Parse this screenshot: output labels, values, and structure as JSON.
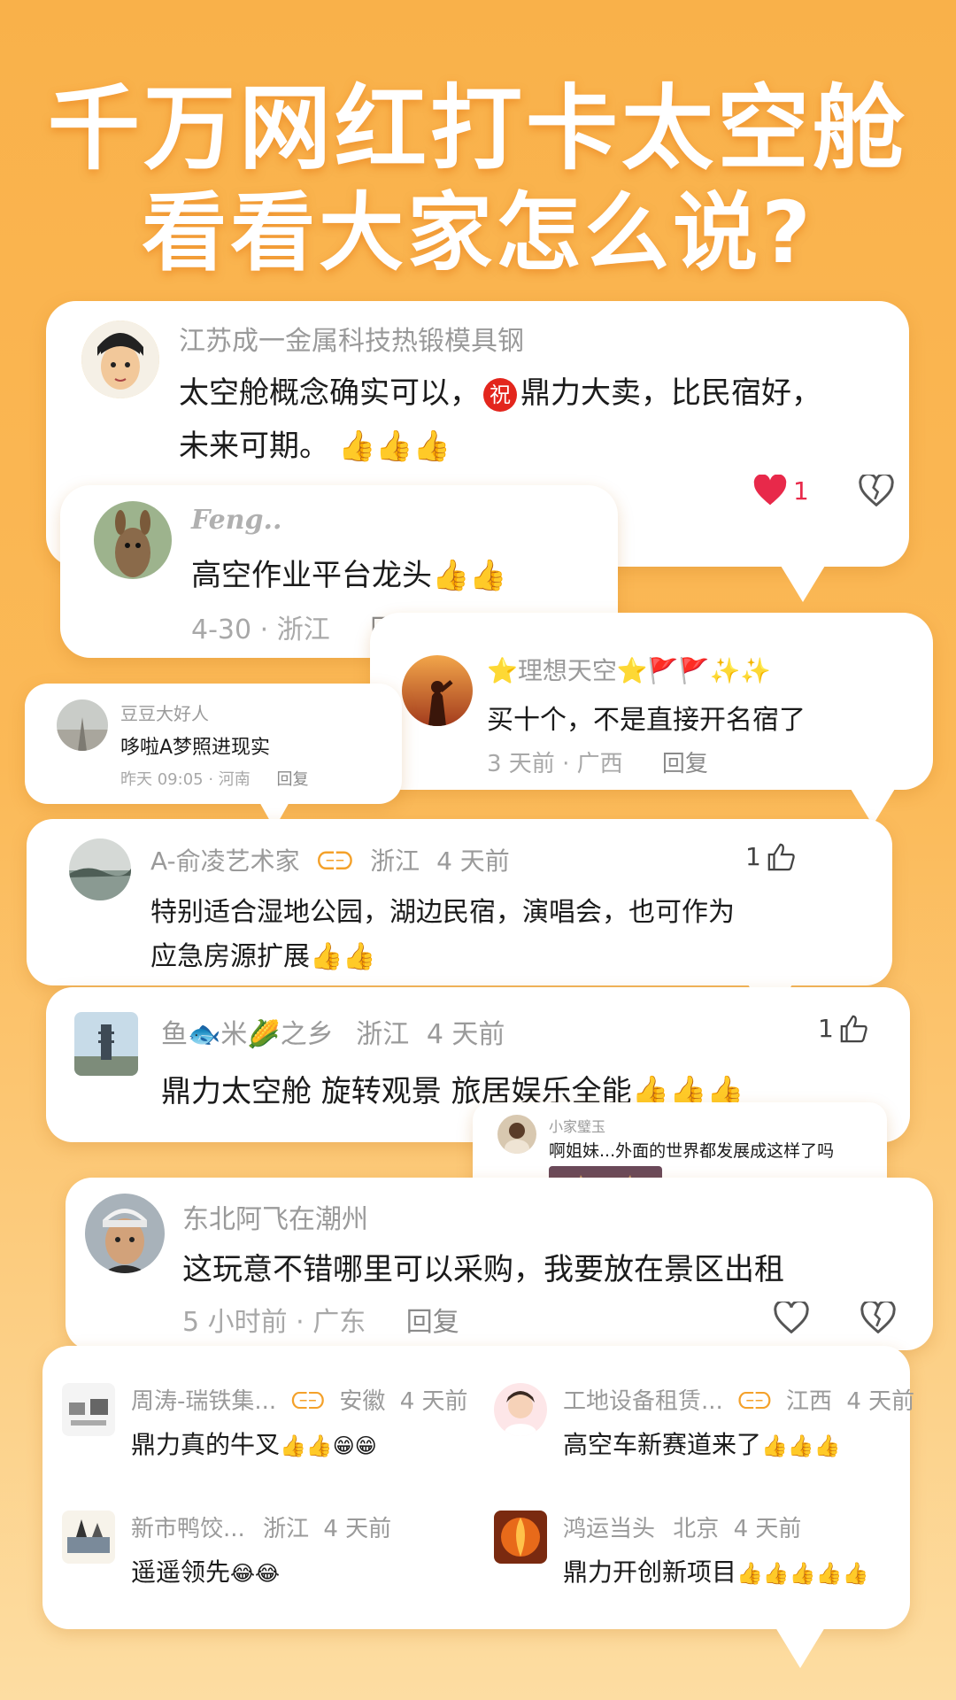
{
  "header": {
    "title_line1": "千万网红打卡太空舱",
    "title_line2": "看看大家怎么说?"
  },
  "comments": {
    "c1": {
      "user": "江苏成一金属科技热锻模具钢",
      "text_a": "太空舱概念确实可以，",
      "badge": "祝",
      "text_b": "鼎力大卖，比民宿好，",
      "text_c": "未来可期。",
      "thumbs": "👍👍👍",
      "likes": "1"
    },
    "c2": {
      "user": "Feng..",
      "text": "高空作业平台龙头",
      "thumbs": "👍👍",
      "date": "4-30",
      "region": "浙江",
      "reply": "回复"
    },
    "c3": {
      "user": "⭐理想天空⭐🚩🚩✨✨",
      "text": "买十个，不是直接开名宿了",
      "time": "3 天前",
      "region": "广西",
      "reply": "回复"
    },
    "c4": {
      "user": "豆豆大好人",
      "text": "哆啦A梦照进现实",
      "time": "昨天 09:05",
      "region": "河南",
      "reply": "回复"
    },
    "c5": {
      "user": "A-俞凌艺术家",
      "badge": "ᕮᕭ",
      "region": "浙江",
      "time": "4 天前",
      "text_a": "特别适合湿地公园，湖边民宿，演唱会，也可作为",
      "text_b": "应急房源扩展",
      "thumbs": "👍👍",
      "likes": "1"
    },
    "c6": {
      "user": "鱼🐟米🌽之乡",
      "region": "浙江",
      "time": "4 天前",
      "text": "鼎力太空舱 旋转观景 旅居娱乐全能",
      "thumbs": "👍👍👍",
      "likes": "1"
    },
    "c7": {
      "user": "小家璧玉",
      "text": "啊姐妹...外面的世界都发展成这样了吗"
    },
    "c8": {
      "user": "东北阿飞在潮州",
      "text": "这玩意不错哪里可以采购，我要放在景区出租",
      "time": "5 小时前",
      "region": "广东",
      "reply": "回复"
    }
  },
  "grid": [
    {
      "user": "周涛-瑞铁集...",
      "badge": "ᕮᕭ",
      "region": "安徽",
      "time": "4 天前",
      "text": "鼎力真的牛叉",
      "emoji": "👍👍😁😁"
    },
    {
      "user": "工地设备租赁...",
      "badge": "ᕮᕭ",
      "region": "江西",
      "time": "4 天前",
      "text": "高空车新赛道来了",
      "emoji": "👍👍👍"
    },
    {
      "user": "新市鸭饺...",
      "badge": "",
      "region": "浙江",
      "time": "4 天前",
      "text": "遥遥领先",
      "emoji": "😂😂"
    },
    {
      "user": "鸿运当头",
      "badge": "",
      "region": "北京",
      "time": "4 天前",
      "text": "鼎力开创新项目",
      "emoji": "👍👍👍👍👍"
    }
  ],
  "colors": {
    "heart": "#E8294A",
    "badge_red": "#E3261D",
    "bg_top": "#F9B14A",
    "bg_bottom": "#FDDDA2"
  }
}
